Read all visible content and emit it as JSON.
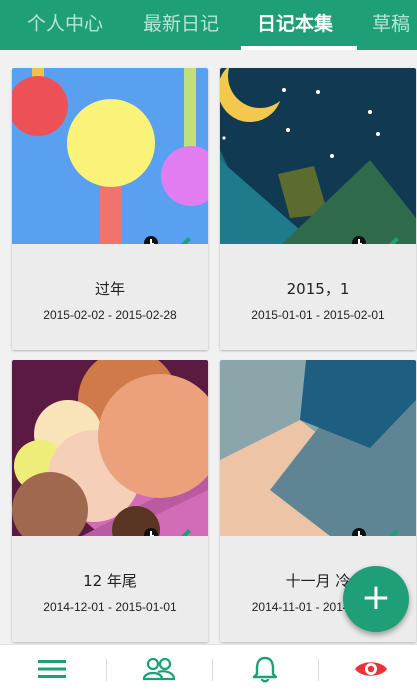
{
  "tabs": [
    {
      "label": "个人中心",
      "active": false
    },
    {
      "label": "最新日记",
      "active": false
    },
    {
      "label": "日记本集",
      "active": true
    },
    {
      "label": "草稿",
      "active": false
    }
  ],
  "diaries": [
    {
      "title": "过年",
      "range": "2015-02-02 - 2015-02-28"
    },
    {
      "title": "2015，1",
      "range": "2015-01-01 - 2015-02-01"
    },
    {
      "title": "12 年尾",
      "range": "2014-12-01 - 2015-01-01"
    },
    {
      "title": "十一月 冷",
      "range": "2014-11-01 - 2014-12-01"
    }
  ],
  "fab": {
    "label": "+"
  },
  "bottom_nav": [
    {
      "icon": "menu-icon"
    },
    {
      "icon": "people-icon"
    },
    {
      "icon": "bell-icon"
    },
    {
      "icon": "eye-icon"
    }
  ],
  "colors": {
    "primary": "#1f9f78",
    "tab_inactive": "#b6e6d3",
    "eye": "#e8333a"
  }
}
